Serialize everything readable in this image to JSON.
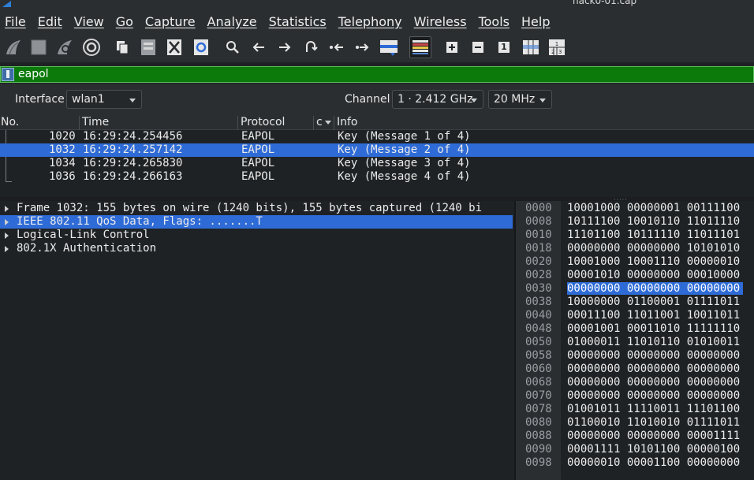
{
  "window": {
    "title": "hack0-01.cap"
  },
  "menubar": [
    "File",
    "Edit",
    "View",
    "Go",
    "Capture",
    "Analyze",
    "Statistics",
    "Telephony",
    "Wireless",
    "Tools",
    "Help"
  ],
  "toolbar": {
    "icons": [
      "start-capture-icon",
      "stop-capture-icon",
      "restart-capture-icon",
      "capture-options-icon",
      "open-file-icon",
      "save-file-icon",
      "close-file-icon",
      "reload-file-icon",
      "find-packet-icon",
      "go-back-icon",
      "go-forward-icon",
      "go-to-packet-icon",
      "first-packet-icon",
      "last-packet-icon",
      "auto-scroll-icon",
      "colorize-icon",
      "zoom-in-icon",
      "zoom-out-icon",
      "normal-size-icon",
      "resize-columns-icon",
      "layout-icon"
    ],
    "zoom_normal_label": "1"
  },
  "filter": {
    "value": "eapol",
    "bg_color": "#0b7a0b"
  },
  "interface_row": {
    "interface_label": "Interface",
    "interface_value": "wlan1",
    "channel_label": "Channel",
    "channel_value": "1 · 2.412 GHz",
    "width_value": "20 MHz"
  },
  "packet_list": {
    "columns": [
      "No.",
      "Time",
      "Protocol",
      "c",
      "Info"
    ],
    "rows": [
      {
        "no": "1020",
        "time": "16:29:24.254456",
        "protocol": "EAPOL",
        "info": "Key (Message 1 of 4)",
        "selected": false
      },
      {
        "no": "1032",
        "time": "16:29:24.257142",
        "protocol": "EAPOL",
        "info": "Key (Message 2 of 4)",
        "selected": true
      },
      {
        "no": "1034",
        "time": "16:29:24.265830",
        "protocol": "EAPOL",
        "info": "Key (Message 3 of 4)",
        "selected": false
      },
      {
        "no": "1036",
        "time": "16:29:24.266163",
        "protocol": "EAPOL",
        "info": "Key (Message 4 of 4)",
        "selected": false
      }
    ]
  },
  "details": [
    {
      "text": "Frame 1032: 155 bytes on wire (1240 bits), 155 bytes captured (1240 bi",
      "selected": false
    },
    {
      "text": "IEEE 802.11 QoS Data, Flags: .......T",
      "selected": true
    },
    {
      "text": "Logical-Link Control",
      "selected": false
    },
    {
      "text": "802.1X Authentication",
      "selected": false
    }
  ],
  "bytes": [
    {
      "offset": "0000",
      "bits": "10001000 00000001 00111100",
      "highlight": false
    },
    {
      "offset": "0008",
      "bits": "10111100 10010110 11011110",
      "highlight": false
    },
    {
      "offset": "0010",
      "bits": "11101100 10111110 11011101",
      "highlight": false
    },
    {
      "offset": "0018",
      "bits": "00000000 00000000 10101010",
      "highlight": false
    },
    {
      "offset": "0020",
      "bits": "10001000 10001110 00000010",
      "highlight": false
    },
    {
      "offset": "0028",
      "bits": "00001010 00000000 00010000",
      "highlight": false
    },
    {
      "offset": "0030",
      "bits": "00000000 00000000 00000000",
      "highlight": true
    },
    {
      "offset": "0038",
      "bits": "10000000 01100001 01111011",
      "highlight": false
    },
    {
      "offset": "0040",
      "bits": "00011100 11011001 10011011",
      "highlight": false
    },
    {
      "offset": "0048",
      "bits": "00001001 00011010 11111110",
      "highlight": false
    },
    {
      "offset": "0050",
      "bits": "01000011 11010110 01010011",
      "highlight": false
    },
    {
      "offset": "0058",
      "bits": "00000000 00000000 00000000",
      "highlight": false
    },
    {
      "offset": "0060",
      "bits": "00000000 00000000 00000000",
      "highlight": false
    },
    {
      "offset": "0068",
      "bits": "00000000 00000000 00000000",
      "highlight": false
    },
    {
      "offset": "0070",
      "bits": "00000000 00000000 00000000",
      "highlight": false
    },
    {
      "offset": "0078",
      "bits": "01001011 11110011 11101100",
      "highlight": false
    },
    {
      "offset": "0080",
      "bits": "01100010 11010010 01111011",
      "highlight": false
    },
    {
      "offset": "0088",
      "bits": "00000000 00000000 00001111",
      "highlight": false
    },
    {
      "offset": "0090",
      "bits": "00001111 10101100 00000100",
      "highlight": false
    },
    {
      "offset": "0098",
      "bits": "00000010 00001100 00000000",
      "highlight": false
    }
  ],
  "colors": {
    "selection": "#2e6bd6",
    "filter_ok": "#0b7a0b",
    "background": "#1f2225"
  }
}
